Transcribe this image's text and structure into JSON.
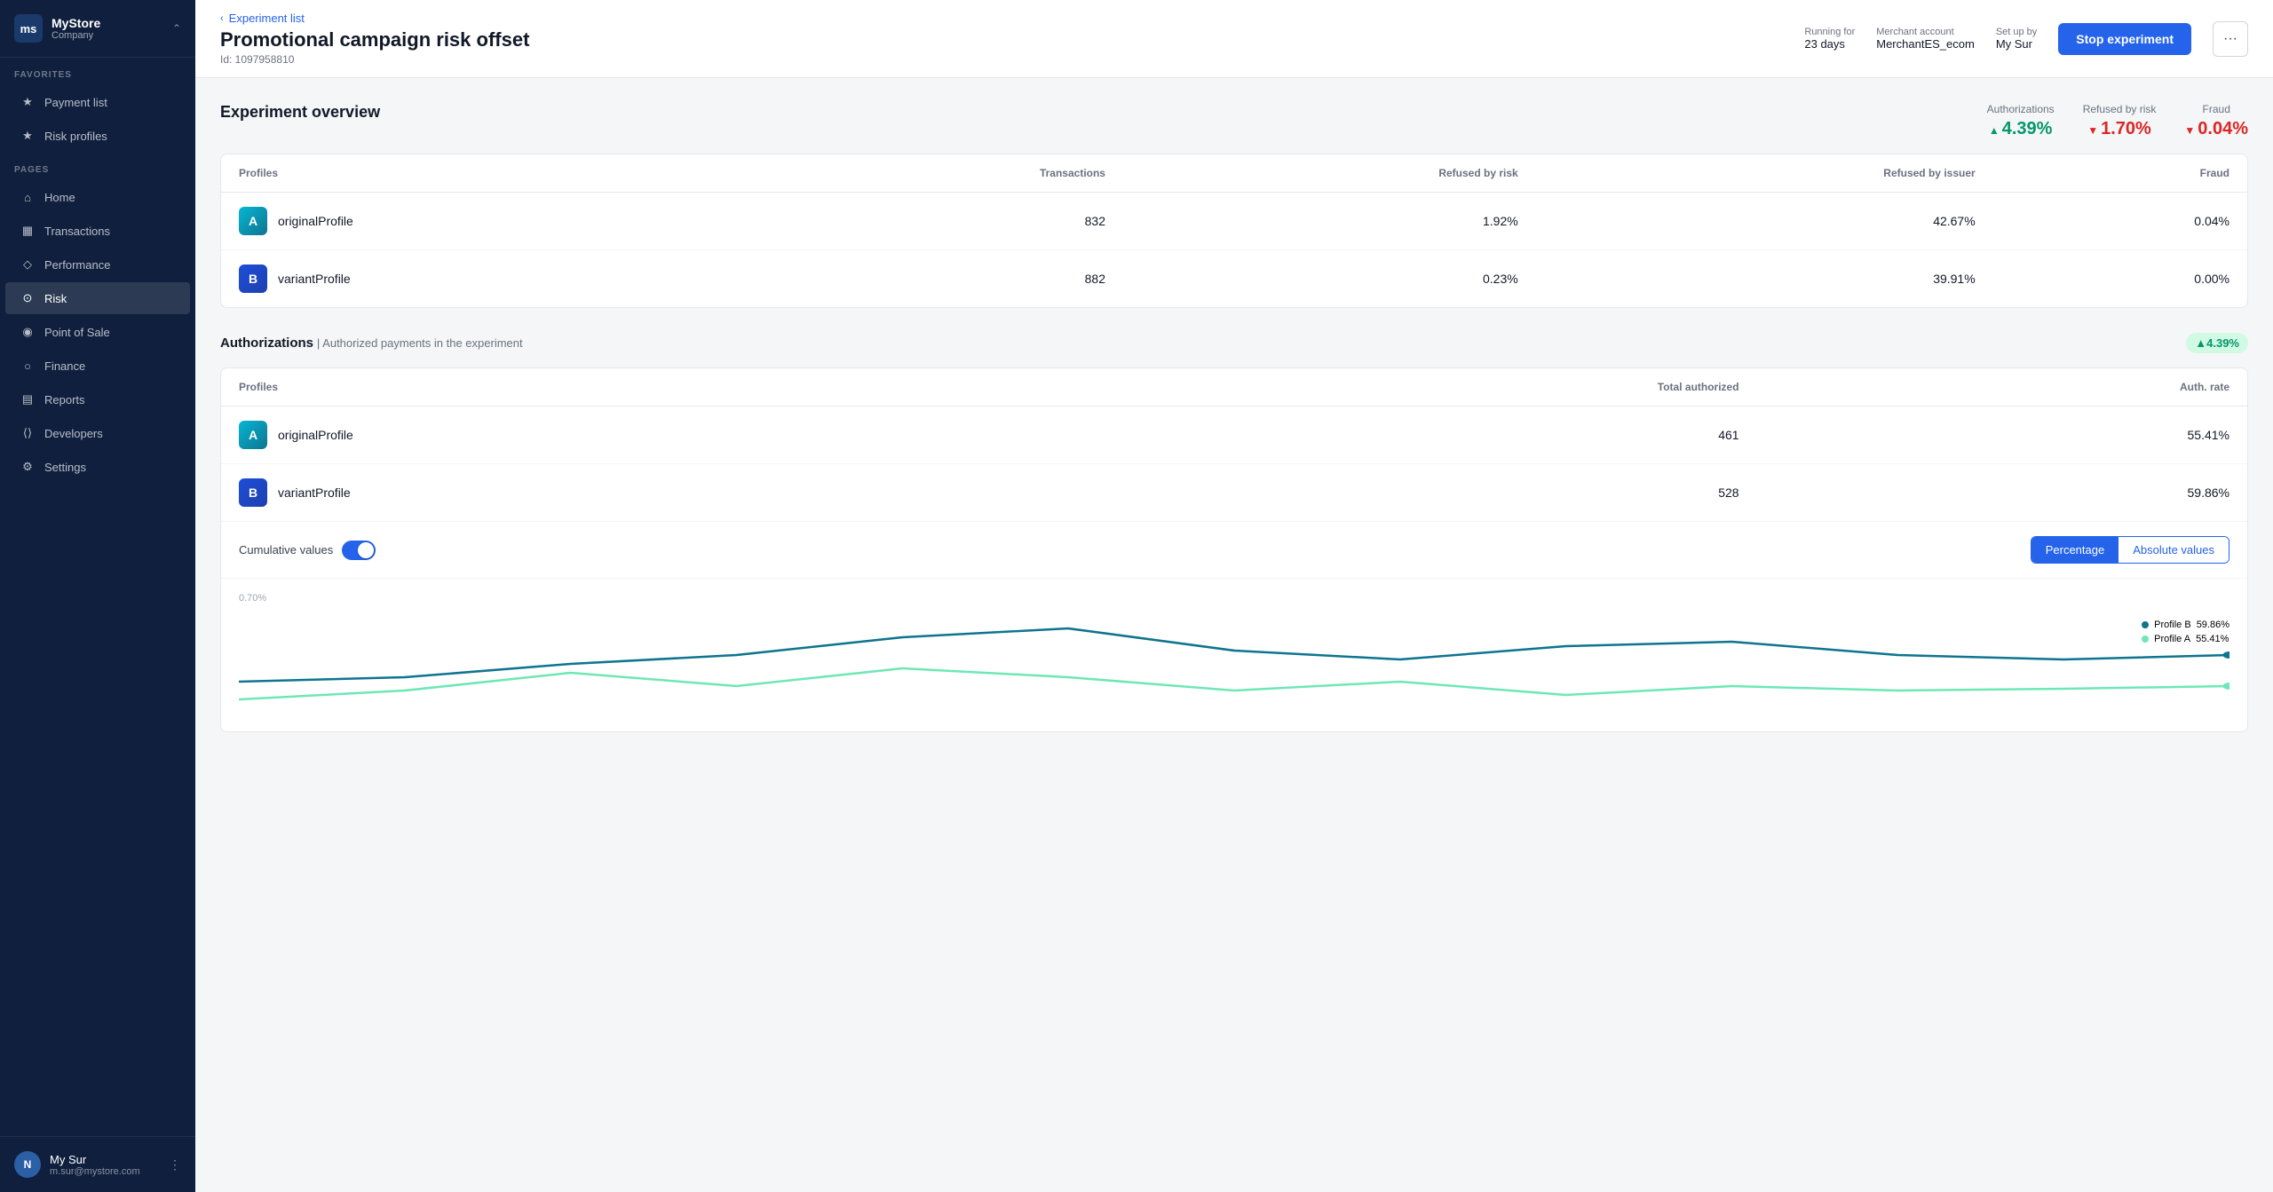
{
  "sidebar": {
    "logo": {
      "initials": "ms",
      "name": "MyStore",
      "company": "Company"
    },
    "sections": {
      "favorites_label": "FAVORITES",
      "pages_label": "PAGES"
    },
    "favorites": [
      {
        "id": "payment-list",
        "label": "Payment list",
        "icon": "★"
      },
      {
        "id": "risk-profiles",
        "label": "Risk profiles",
        "icon": "★"
      }
    ],
    "nav_items": [
      {
        "id": "home",
        "label": "Home",
        "active": false
      },
      {
        "id": "transactions",
        "label": "Transactions",
        "active": false
      },
      {
        "id": "performance",
        "label": "Performance",
        "active": false
      },
      {
        "id": "risk",
        "label": "Risk",
        "active": true
      },
      {
        "id": "point-of-sale",
        "label": "Point of Sale",
        "active": false
      },
      {
        "id": "finance",
        "label": "Finance",
        "active": false
      },
      {
        "id": "reports",
        "label": "Reports",
        "active": false
      },
      {
        "id": "developers",
        "label": "Developers",
        "active": false
      },
      {
        "id": "settings",
        "label": "Settings",
        "active": false
      }
    ],
    "user": {
      "avatar": "N",
      "name": "My Sur",
      "email": "m.sur@mystore.com"
    }
  },
  "topbar": {
    "breadcrumb": "Experiment list",
    "title": "Promotional campaign risk offset",
    "subtitle": "Id: 1097958810",
    "running_for_label": "Running for",
    "running_for_value": "23 days",
    "merchant_label": "Merchant account",
    "merchant_value": "MerchantES_ecom",
    "setup_label": "Set up by",
    "setup_value": "My Sur",
    "stop_button": "Stop experiment",
    "dots_button": "···"
  },
  "overview": {
    "title": "Experiment overview",
    "metrics": {
      "authorizations_label": "Authorizations",
      "authorizations_value": "4.39%",
      "authorizations_direction": "up",
      "refused_label": "Refused by risk",
      "refused_value": "1.70%",
      "refused_direction": "down",
      "fraud_label": "Fraud",
      "fraud_value": "0.04%",
      "fraud_direction": "down"
    },
    "table": {
      "headers": [
        "Profiles",
        "Transactions",
        "Refused by risk",
        "Refused by issuer",
        "Fraud"
      ],
      "rows": [
        {
          "badge": "A",
          "badge_class": "badge-a",
          "name": "originalProfile",
          "transactions": "832",
          "refused_by_risk": "1.92%",
          "refused_by_issuer": "42.67%",
          "fraud": "0.04%"
        },
        {
          "badge": "B",
          "badge_class": "badge-b",
          "name": "variantProfile",
          "transactions": "882",
          "refused_by_risk": "0.23%",
          "refused_by_issuer": "39.91%",
          "fraud": "0.00%"
        }
      ]
    }
  },
  "authorizations": {
    "title": "Authorizations",
    "subtitle": "| Authorized payments in the experiment",
    "badge": "▲4.39%",
    "table": {
      "headers": [
        "Profiles",
        "Total authorized",
        "Auth. rate"
      ],
      "rows": [
        {
          "badge": "A",
          "badge_class": "badge-a",
          "name": "originalProfile",
          "total_authorized": "461",
          "auth_rate": "55.41%"
        },
        {
          "badge": "B",
          "badge_class": "badge-b",
          "name": "variantProfile",
          "total_authorized": "528",
          "auth_rate": "59.86%"
        }
      ]
    },
    "cumulative_label": "Cumulative values",
    "toggle_on": true,
    "btn_percentage": "Percentage",
    "btn_absolute": "Absolute values",
    "chart": {
      "y_label": "0.70%",
      "legend": [
        {
          "label": "Profile B",
          "value": "59.86%",
          "color": "#0e7490"
        },
        {
          "label": "Profile A",
          "value": "55.41%",
          "color": "#6ee7b7"
        }
      ]
    }
  }
}
